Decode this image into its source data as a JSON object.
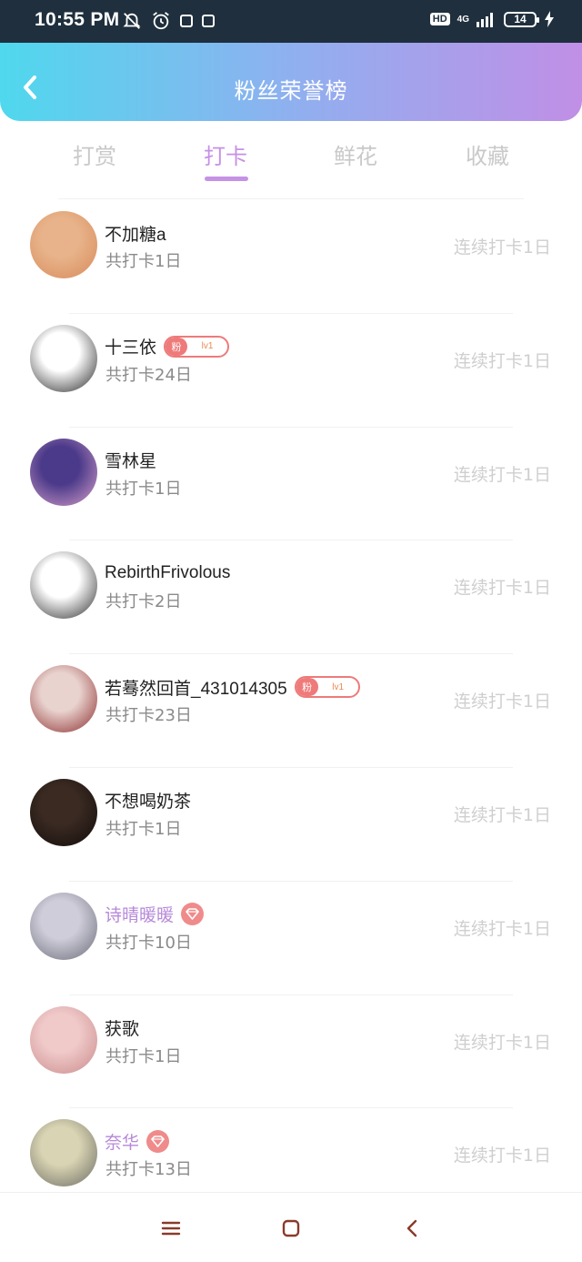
{
  "status_bar": {
    "time": "10:55 PM",
    "left_icons": [
      "mute-bell-icon",
      "alarm-icon",
      "app-notification-icon",
      "app-notification-icon"
    ],
    "hd_label": "HD",
    "network_label": "4G",
    "battery_level": "14"
  },
  "header": {
    "title": "粉丝荣誉榜",
    "back_icon": "chevron-left-icon"
  },
  "tabs": [
    {
      "label": "打赏",
      "active": false
    },
    {
      "label": "打卡",
      "active": true
    },
    {
      "label": "鲜花",
      "active": false
    },
    {
      "label": "收藏",
      "active": false
    }
  ],
  "list": [
    {
      "name": "不加糖a",
      "total": "共打卡1日",
      "streak": "连续打卡1日",
      "badge": "none",
      "avatar_colors": [
        "#e8b38a",
        "#d78a5a"
      ]
    },
    {
      "name": "十三依",
      "total": "共打卡24日",
      "streak": "连续打卡1日",
      "badge": "fan",
      "fan_label": "粉",
      "fan_level": "lv1",
      "avatar_colors": [
        "#ffffff",
        "#222222"
      ]
    },
    {
      "name": "雪林星",
      "total": "共打卡1日",
      "streak": "连续打卡1日",
      "badge": "none",
      "avatar_colors": [
        "#4b3a8a",
        "#d79fc9"
      ]
    },
    {
      "name": "RebirthFrivolous",
      "total": "共打卡2日",
      "streak": "连续打卡1日",
      "badge": "none",
      "avatar_colors": [
        "#ffffff",
        "#2a2a2a"
      ]
    },
    {
      "name": "若蓦然回首_431014305",
      "total": "共打卡23日",
      "streak": "连续打卡1日",
      "badge": "fan",
      "fan_label": "粉",
      "fan_level": "lv1",
      "avatar_colors": [
        "#e9d3cf",
        "#8a2a2a"
      ]
    },
    {
      "name": "不想喝奶茶",
      "total": "共打卡1日",
      "streak": "连续打卡1日",
      "badge": "none",
      "avatar_colors": [
        "#3a2a22",
        "#120c0a"
      ]
    },
    {
      "name": "诗晴暖暖",
      "total": "共打卡10日",
      "streak": "连续打卡1日",
      "badge": "vip",
      "vip": true,
      "avatar_colors": [
        "#cfcdd9",
        "#6a6c7a"
      ]
    },
    {
      "name": "获歌",
      "total": "共打卡1日",
      "streak": "连续打卡1日",
      "badge": "none",
      "avatar_colors": [
        "#f0c9c9",
        "#c98a8a"
      ]
    },
    {
      "name": "奈华",
      "total": "共打卡13日",
      "streak": "连续打卡1日",
      "badge": "vip",
      "vip": true,
      "avatar_colors": [
        "#d9d4b3",
        "#6a6a62"
      ]
    }
  ],
  "nav": {
    "icons": [
      "menu-icon",
      "home-square-icon",
      "back-icon"
    ]
  },
  "colors": {
    "accent": "#c692e6",
    "header_gradient": [
      "#4fd8ee",
      "#8fb0ef",
      "#c08fe6"
    ],
    "fan_badge": "#ee7a7a",
    "vip_name": "#b689d9",
    "inactive_tab": "#c9c9c9",
    "streak_text": "#cfcfcf"
  }
}
